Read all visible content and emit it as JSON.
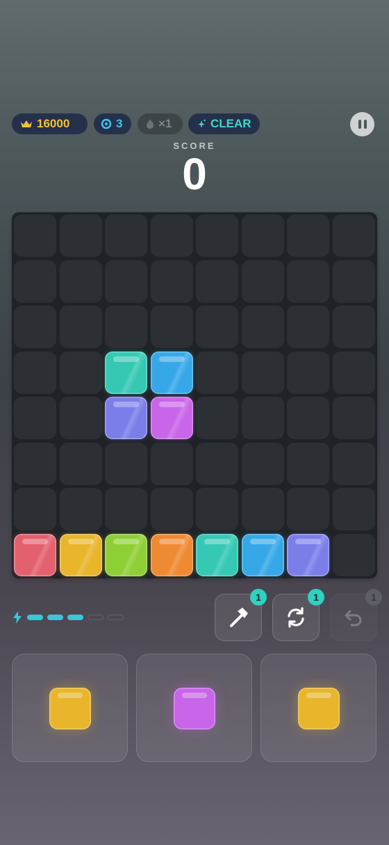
{
  "hud": {
    "best_score": "16000",
    "gems": "3",
    "combo": "×1",
    "clear_label": "CLEAR"
  },
  "score": {
    "label": "SCORE",
    "value": "0"
  },
  "colors": {
    "red": "#e3606e",
    "yellow": "#e9b52b",
    "green": "#8fcf36",
    "orange": "#ee8a32",
    "teal": "#35c9b4",
    "blue": "#36a8e8",
    "indigo": "#7b7ee8",
    "violet": "#c865e8"
  },
  "board": {
    "rows": 8,
    "cols": 8,
    "grid": [
      [
        null,
        null,
        null,
        null,
        null,
        null,
        null,
        null
      ],
      [
        null,
        null,
        null,
        null,
        null,
        null,
        null,
        null
      ],
      [
        null,
        null,
        null,
        null,
        null,
        null,
        null,
        null
      ],
      [
        null,
        null,
        "teal",
        "blue",
        null,
        null,
        null,
        null
      ],
      [
        null,
        null,
        "indigo",
        "violet",
        null,
        null,
        null,
        null
      ],
      [
        null,
        null,
        null,
        null,
        null,
        null,
        null,
        null
      ],
      [
        null,
        null,
        null,
        null,
        null,
        null,
        null,
        null
      ],
      [
        "red",
        "yellow",
        "green",
        "orange",
        "teal",
        "blue",
        "indigo",
        null
      ]
    ]
  },
  "energy": {
    "filled": 3,
    "total": 5
  },
  "tools": {
    "hammer_count": "1",
    "refresh_count": "1",
    "undo_count": "1"
  },
  "tray": [
    "yellow",
    "violet",
    "yellow"
  ]
}
